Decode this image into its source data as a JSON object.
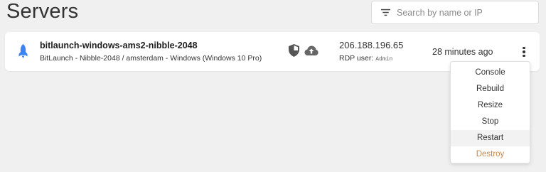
{
  "header": {
    "title": "Servers"
  },
  "search": {
    "placeholder": "Search by name or IP",
    "value": ""
  },
  "server": {
    "icon": "rocket-icon",
    "name": "bitlaunch-windows-ams2-nibble-2048",
    "subtitle": "BitLaunch - Nibble-2048 / amsterdam - Windows (Windows 10 Pro)",
    "status_icons": [
      "shield-icon",
      "cloud-upload-icon"
    ],
    "ip": "206.188.196.65",
    "rdp_label": "RDP user:",
    "rdp_user": "Admin",
    "created": "28 minutes ago"
  },
  "menu": {
    "items": [
      {
        "label": "Console"
      },
      {
        "label": "Rebuild"
      },
      {
        "label": "Resize"
      },
      {
        "label": "Stop"
      },
      {
        "label": "Restart"
      },
      {
        "label": "Destroy"
      }
    ]
  },
  "colors": {
    "accent": "#3a82f6",
    "danger": "#c4884c",
    "background": "#f0f0f1"
  }
}
